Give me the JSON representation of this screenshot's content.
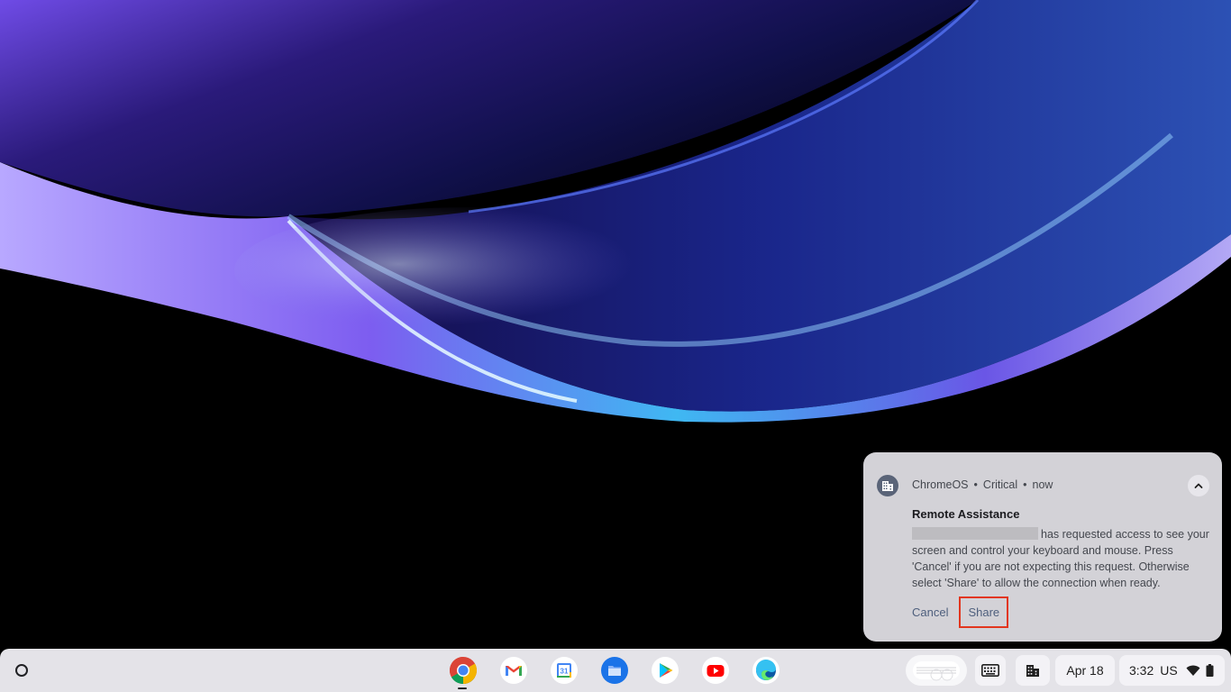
{
  "notification": {
    "app_name": "ChromeOS",
    "priority": "Critical",
    "timestamp": "now",
    "separator": "•",
    "title": "Remote Assistance",
    "body": "has requested access to see your screen and control your keyboard and mouse. Press 'Cancel' if you are not expecting this request. Otherwise select 'Share' to allow the connection when ready.",
    "cancel_label": "Cancel",
    "share_label": "Share",
    "highlight_color": "#e2361e"
  },
  "shelf": {
    "apps": [
      {
        "name": "Chrome",
        "icon": "chrome-icon"
      },
      {
        "name": "Gmail",
        "icon": "gmail-icon"
      },
      {
        "name": "Calendar",
        "icon": "calendar-icon",
        "badge": "31"
      },
      {
        "name": "Files",
        "icon": "files-icon"
      },
      {
        "name": "Play Store",
        "icon": "play-store-icon"
      },
      {
        "name": "YouTube",
        "icon": "youtube-icon"
      },
      {
        "name": "Edge",
        "icon": "edge-icon"
      }
    ]
  },
  "tray": {
    "date": "Apr 18",
    "time": "3:32",
    "input_method": "US"
  }
}
